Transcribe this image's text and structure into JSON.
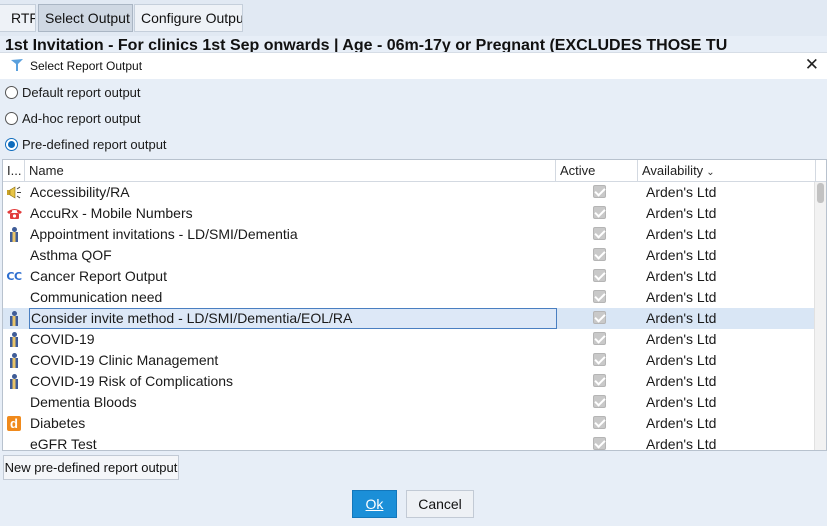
{
  "toolbar": {
    "rtf_label": "RTF",
    "select_output_label": "Select Output",
    "configure_output_label": "Configure Output"
  },
  "background_title": "1st Invitation - For clinics 1st Sep onwards | Age - 06m-17y or Pregnant (EXCLUDES THOSE TU",
  "dialog": {
    "title": "Select Report Output",
    "close_icon": "close-icon",
    "options": {
      "default_label": "Default report output",
      "adhoc_label": "Ad-hoc report output",
      "predefined_label": "Pre-defined report output",
      "selected": "predefined"
    },
    "columns": {
      "icon": "I...",
      "name": "Name",
      "active": "Active",
      "availability": "Availability"
    },
    "rows": [
      {
        "icon": "speaker-icon",
        "name": "Accessibility/RA",
        "active": true,
        "availability": "Arden's Ltd"
      },
      {
        "icon": "phone-icon",
        "name": "AccuRx - Mobile Numbers",
        "active": true,
        "availability": "Arden's Ltd"
      },
      {
        "icon": "person-icon",
        "name": "Appointment invitations - LD/SMI/Dementia",
        "active": true,
        "availability": "Arden's Ltd"
      },
      {
        "icon": "",
        "name": "Asthma QOF",
        "active": true,
        "availability": "Arden's Ltd"
      },
      {
        "icon": "cc-icon",
        "name": "Cancer Report Output",
        "active": true,
        "availability": "Arden's Ltd"
      },
      {
        "icon": "",
        "name": "Communication need",
        "active": true,
        "availability": "Arden's Ltd"
      },
      {
        "icon": "person-icon",
        "name": "Consider invite method - LD/SMI/Dementia/EOL/RA",
        "active": true,
        "availability": "Arden's Ltd",
        "selected": true
      },
      {
        "icon": "person-icon",
        "name": "COVID-19",
        "active": true,
        "availability": "Arden's Ltd"
      },
      {
        "icon": "person-icon",
        "name": "COVID-19 Clinic Management",
        "active": true,
        "availability": "Arden's Ltd"
      },
      {
        "icon": "person-icon",
        "name": "COVID-19 Risk of Complications",
        "active": true,
        "availability": "Arden's Ltd"
      },
      {
        "icon": "",
        "name": "Dementia Bloods",
        "active": true,
        "availability": "Arden's Ltd"
      },
      {
        "icon": "d-icon",
        "name": "Diabetes",
        "active": true,
        "availability": "Arden's Ltd"
      },
      {
        "icon": "",
        "name": "eGFR Test",
        "active": true,
        "availability": "Arden's Ltd"
      }
    ],
    "new_button_label": "New pre-defined report output",
    "ok_label": "Ok",
    "cancel_label": "Cancel"
  }
}
